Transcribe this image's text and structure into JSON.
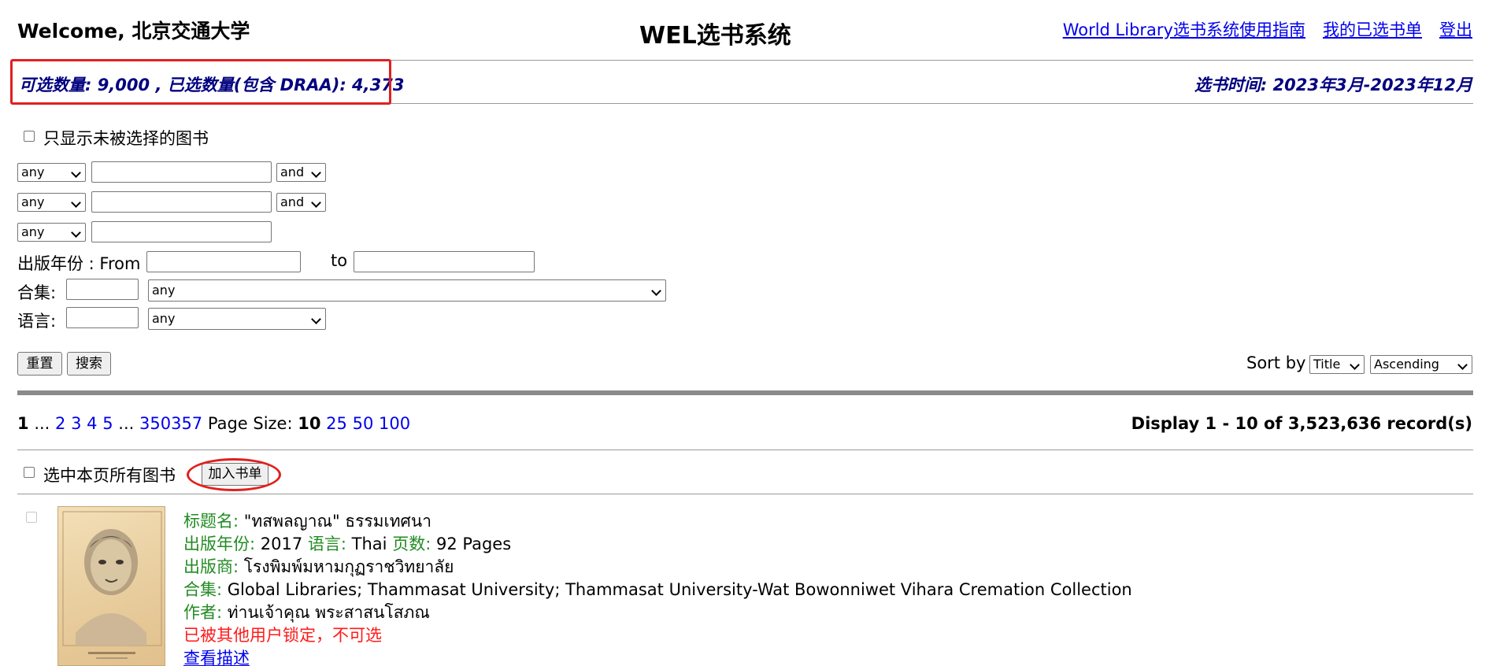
{
  "header": {
    "welcome": "Welcome, 北京交通大学",
    "title": "WEL选书系统",
    "links": [
      "World Library选书系统使用指南",
      "我的已选书单",
      "登出"
    ]
  },
  "quota": {
    "text": "可选数量: 9,000 , 已选数量(包含 DRAA): 4,373",
    "period": "选书时间: 2023年3月-2023年12月"
  },
  "filters": {
    "unselected_only_label": "只显示未被选择的图书",
    "rows": [
      {
        "field": "any",
        "op": "and"
      },
      {
        "field": "any",
        "op": "and"
      },
      {
        "field": "any"
      }
    ],
    "year_label": "出版年份 : From",
    "year_to": "to",
    "collection_label": "合集:",
    "collection_value": "any",
    "language_label": "语言:",
    "language_value": "any",
    "reset_label": "重置",
    "search_label": "搜索",
    "sort_label": "Sort by",
    "sort_field": "Title",
    "sort_order": "Ascending"
  },
  "pagination": {
    "current": "1",
    "ellipsis": "...",
    "pages": [
      "2",
      "3",
      "4",
      "5"
    ],
    "last": "350357",
    "page_size_label": "Page Size:",
    "page_size_current": "10",
    "page_size_options": [
      "25",
      "50",
      "100"
    ],
    "display": "Display 1 - 10 of 3,523,636 record(s)"
  },
  "selection": {
    "select_all_label": "选中本页所有图书",
    "add_label": "加入书单"
  },
  "record": {
    "title_label": "标题名:",
    "title": "\"ทสพลญาณ\" ธรรมเทศนา",
    "year_label": "出版年份:",
    "year": "2017",
    "lang_label": "语言:",
    "lang": "Thai",
    "pages_label": "页数:",
    "pages": "92 Pages",
    "publisher_label": "出版商:",
    "publisher": "โรงพิมพ์มหามกุฏราชวิทยาลัย",
    "collection_label": "合集:",
    "collection": "Global Libraries; Thammasat University; Thammasat University-Wat Bowonniwet Vihara Cremation Collection",
    "author_label": "作者:",
    "author": "ท่านเจ้าคุณ พระสาสนโสภณ",
    "locked": "已被其他用户锁定，不可选",
    "view_desc": "查看描述"
  },
  "colors": {
    "accent_red": "#e0201f",
    "link_blue": "#0000ee",
    "label_green": "#228b22",
    "quota_navy": "#000080"
  }
}
